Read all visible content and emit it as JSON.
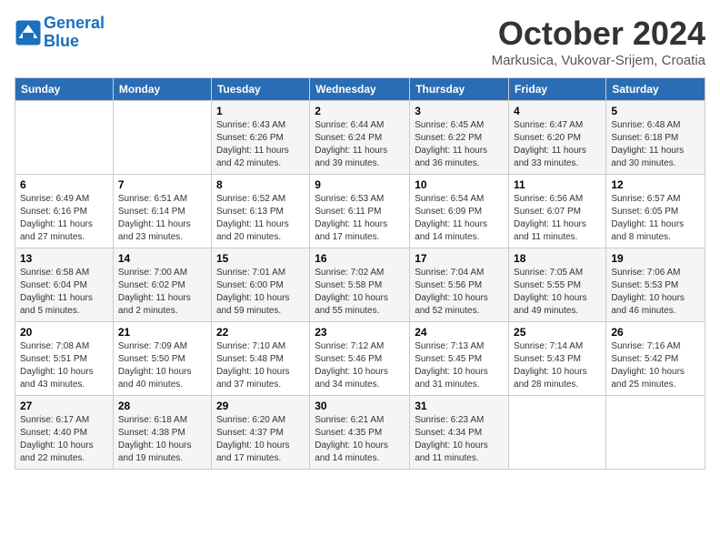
{
  "header": {
    "logo_line1": "General",
    "logo_line2": "Blue",
    "month": "October 2024",
    "location": "Markusica, Vukovar-Srijem, Croatia"
  },
  "weekdays": [
    "Sunday",
    "Monday",
    "Tuesday",
    "Wednesday",
    "Thursday",
    "Friday",
    "Saturday"
  ],
  "weeks": [
    [
      {
        "day": "",
        "sunrise": "",
        "sunset": "",
        "daylight": ""
      },
      {
        "day": "",
        "sunrise": "",
        "sunset": "",
        "daylight": ""
      },
      {
        "day": "1",
        "sunrise": "Sunrise: 6:43 AM",
        "sunset": "Sunset: 6:26 PM",
        "daylight": "Daylight: 11 hours and 42 minutes."
      },
      {
        "day": "2",
        "sunrise": "Sunrise: 6:44 AM",
        "sunset": "Sunset: 6:24 PM",
        "daylight": "Daylight: 11 hours and 39 minutes."
      },
      {
        "day": "3",
        "sunrise": "Sunrise: 6:45 AM",
        "sunset": "Sunset: 6:22 PM",
        "daylight": "Daylight: 11 hours and 36 minutes."
      },
      {
        "day": "4",
        "sunrise": "Sunrise: 6:47 AM",
        "sunset": "Sunset: 6:20 PM",
        "daylight": "Daylight: 11 hours and 33 minutes."
      },
      {
        "day": "5",
        "sunrise": "Sunrise: 6:48 AM",
        "sunset": "Sunset: 6:18 PM",
        "daylight": "Daylight: 11 hours and 30 minutes."
      }
    ],
    [
      {
        "day": "6",
        "sunrise": "Sunrise: 6:49 AM",
        "sunset": "Sunset: 6:16 PM",
        "daylight": "Daylight: 11 hours and 27 minutes."
      },
      {
        "day": "7",
        "sunrise": "Sunrise: 6:51 AM",
        "sunset": "Sunset: 6:14 PM",
        "daylight": "Daylight: 11 hours and 23 minutes."
      },
      {
        "day": "8",
        "sunrise": "Sunrise: 6:52 AM",
        "sunset": "Sunset: 6:13 PM",
        "daylight": "Daylight: 11 hours and 20 minutes."
      },
      {
        "day": "9",
        "sunrise": "Sunrise: 6:53 AM",
        "sunset": "Sunset: 6:11 PM",
        "daylight": "Daylight: 11 hours and 17 minutes."
      },
      {
        "day": "10",
        "sunrise": "Sunrise: 6:54 AM",
        "sunset": "Sunset: 6:09 PM",
        "daylight": "Daylight: 11 hours and 14 minutes."
      },
      {
        "day": "11",
        "sunrise": "Sunrise: 6:56 AM",
        "sunset": "Sunset: 6:07 PM",
        "daylight": "Daylight: 11 hours and 11 minutes."
      },
      {
        "day": "12",
        "sunrise": "Sunrise: 6:57 AM",
        "sunset": "Sunset: 6:05 PM",
        "daylight": "Daylight: 11 hours and 8 minutes."
      }
    ],
    [
      {
        "day": "13",
        "sunrise": "Sunrise: 6:58 AM",
        "sunset": "Sunset: 6:04 PM",
        "daylight": "Daylight: 11 hours and 5 minutes."
      },
      {
        "day": "14",
        "sunrise": "Sunrise: 7:00 AM",
        "sunset": "Sunset: 6:02 PM",
        "daylight": "Daylight: 11 hours and 2 minutes."
      },
      {
        "day": "15",
        "sunrise": "Sunrise: 7:01 AM",
        "sunset": "Sunset: 6:00 PM",
        "daylight": "Daylight: 10 hours and 59 minutes."
      },
      {
        "day": "16",
        "sunrise": "Sunrise: 7:02 AM",
        "sunset": "Sunset: 5:58 PM",
        "daylight": "Daylight: 10 hours and 55 minutes."
      },
      {
        "day": "17",
        "sunrise": "Sunrise: 7:04 AM",
        "sunset": "Sunset: 5:56 PM",
        "daylight": "Daylight: 10 hours and 52 minutes."
      },
      {
        "day": "18",
        "sunrise": "Sunrise: 7:05 AM",
        "sunset": "Sunset: 5:55 PM",
        "daylight": "Daylight: 10 hours and 49 minutes."
      },
      {
        "day": "19",
        "sunrise": "Sunrise: 7:06 AM",
        "sunset": "Sunset: 5:53 PM",
        "daylight": "Daylight: 10 hours and 46 minutes."
      }
    ],
    [
      {
        "day": "20",
        "sunrise": "Sunrise: 7:08 AM",
        "sunset": "Sunset: 5:51 PM",
        "daylight": "Daylight: 10 hours and 43 minutes."
      },
      {
        "day": "21",
        "sunrise": "Sunrise: 7:09 AM",
        "sunset": "Sunset: 5:50 PM",
        "daylight": "Daylight: 10 hours and 40 minutes."
      },
      {
        "day": "22",
        "sunrise": "Sunrise: 7:10 AM",
        "sunset": "Sunset: 5:48 PM",
        "daylight": "Daylight: 10 hours and 37 minutes."
      },
      {
        "day": "23",
        "sunrise": "Sunrise: 7:12 AM",
        "sunset": "Sunset: 5:46 PM",
        "daylight": "Daylight: 10 hours and 34 minutes."
      },
      {
        "day": "24",
        "sunrise": "Sunrise: 7:13 AM",
        "sunset": "Sunset: 5:45 PM",
        "daylight": "Daylight: 10 hours and 31 minutes."
      },
      {
        "day": "25",
        "sunrise": "Sunrise: 7:14 AM",
        "sunset": "Sunset: 5:43 PM",
        "daylight": "Daylight: 10 hours and 28 minutes."
      },
      {
        "day": "26",
        "sunrise": "Sunrise: 7:16 AM",
        "sunset": "Sunset: 5:42 PM",
        "daylight": "Daylight: 10 hours and 25 minutes."
      }
    ],
    [
      {
        "day": "27",
        "sunrise": "Sunrise: 6:17 AM",
        "sunset": "Sunset: 4:40 PM",
        "daylight": "Daylight: 10 hours and 22 minutes."
      },
      {
        "day": "28",
        "sunrise": "Sunrise: 6:18 AM",
        "sunset": "Sunset: 4:38 PM",
        "daylight": "Daylight: 10 hours and 19 minutes."
      },
      {
        "day": "29",
        "sunrise": "Sunrise: 6:20 AM",
        "sunset": "Sunset: 4:37 PM",
        "daylight": "Daylight: 10 hours and 17 minutes."
      },
      {
        "day": "30",
        "sunrise": "Sunrise: 6:21 AM",
        "sunset": "Sunset: 4:35 PM",
        "daylight": "Daylight: 10 hours and 14 minutes."
      },
      {
        "day": "31",
        "sunrise": "Sunrise: 6:23 AM",
        "sunset": "Sunset: 4:34 PM",
        "daylight": "Daylight: 10 hours and 11 minutes."
      },
      {
        "day": "",
        "sunrise": "",
        "sunset": "",
        "daylight": ""
      },
      {
        "day": "",
        "sunrise": "",
        "sunset": "",
        "daylight": ""
      }
    ]
  ]
}
